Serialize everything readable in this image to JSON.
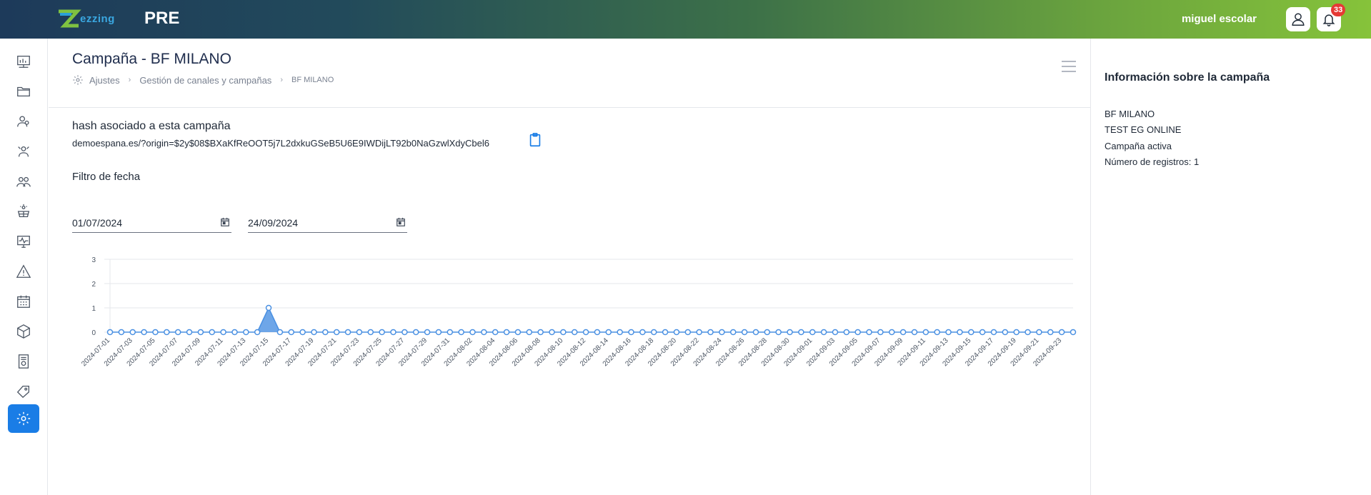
{
  "header": {
    "logo_text": "ezzing",
    "environment": "PRE",
    "username": "miguel escolar",
    "notifications_count": "33"
  },
  "sidebar": {
    "items": [
      {
        "icon": "dashboard-icon"
      },
      {
        "icon": "folder-icon"
      },
      {
        "icon": "users-icon"
      },
      {
        "icon": "installers-icon"
      },
      {
        "icon": "groups-icon"
      },
      {
        "icon": "solar-panel-icon"
      },
      {
        "icon": "monitoring-icon"
      },
      {
        "icon": "alert-icon"
      },
      {
        "icon": "calendar-icon"
      },
      {
        "icon": "box-icon"
      },
      {
        "icon": "invoice-icon"
      },
      {
        "icon": "tag-icon"
      },
      {
        "icon": "settings-icon",
        "active": true
      }
    ]
  },
  "page": {
    "title": "Campaña - BF MILANO",
    "breadcrumb": [
      "Ajustes",
      "Gestión de canales y campañas",
      "BF MILANO"
    ],
    "hash_label": "hash asociado a esta campaña",
    "hash_value": "demoespana.es/?origin=$2y$08$BXaKfReOOT5j7L2dxkuGSeB5U6E9IWDijLT92b0NaGzwlXdyCbel6",
    "filter_label": "Filtro de fecha",
    "date_from": "01/07/2024",
    "date_to": "24/09/2024"
  },
  "right_panel": {
    "title": "Información sobre la campaña",
    "lines": [
      "BF MILANO",
      "TEST EG ONLINE",
      "Campaña activa",
      "Número de registros: 1"
    ]
  },
  "chart_data": {
    "type": "area",
    "x_start": "2024-07-01",
    "x_end": "2024-09-24",
    "x_tick_labels": [
      "2024-07-01",
      "2024-07-03",
      "2024-07-05",
      "2024-07-07",
      "2024-07-09",
      "2024-07-11",
      "2024-07-13",
      "2024-07-15",
      "2024-07-17",
      "2024-07-19",
      "2024-07-21",
      "2024-07-23",
      "2024-07-25",
      "2024-07-27",
      "2024-07-29",
      "2024-07-31",
      "2024-08-02",
      "2024-08-04",
      "2024-08-06",
      "2024-08-08",
      "2024-08-10",
      "2024-08-12",
      "2024-08-14",
      "2024-08-16",
      "2024-08-18",
      "2024-08-20",
      "2024-08-22",
      "2024-08-24",
      "2024-08-26",
      "2024-08-28",
      "2024-08-30",
      "2024-09-01",
      "2024-09-03",
      "2024-09-05",
      "2024-09-07",
      "2024-09-09",
      "2024-09-11",
      "2024-09-13",
      "2024-09-15",
      "2024-09-17",
      "2024-09-19",
      "2024-09-21",
      "2024-09-23"
    ],
    "y_ticks": [
      0,
      1,
      2,
      3
    ],
    "ylim": [
      0,
      3
    ],
    "points": [
      {
        "x": "2024-07-15",
        "y": 1
      }
    ],
    "default_y": 0,
    "color": "#4a90e2",
    "grid": true
  }
}
